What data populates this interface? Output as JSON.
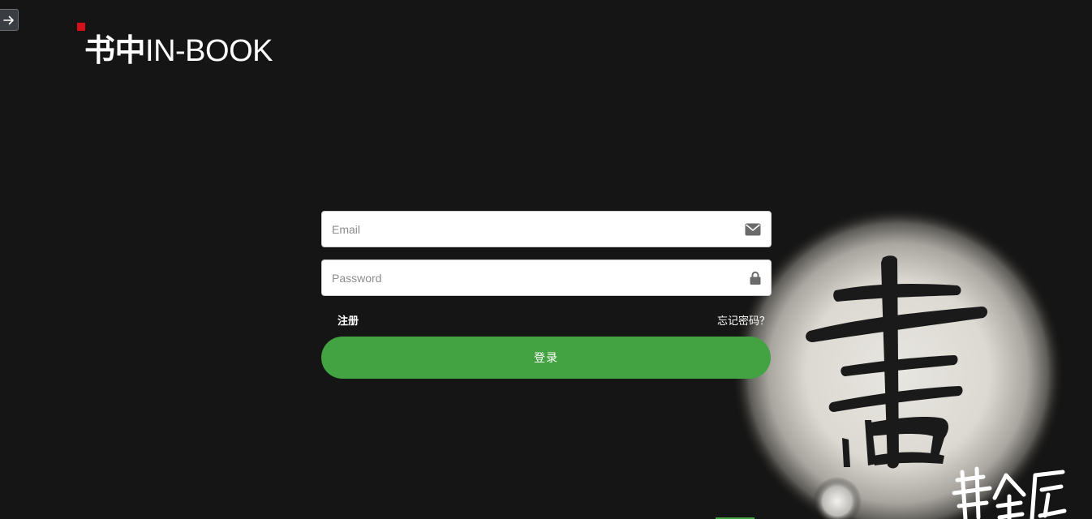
{
  "sidebar_toggle": {
    "icon": "arrow-right-icon"
  },
  "brand": {
    "name_cn": "书中",
    "name_en": "IN-BOOK",
    "accent_color": "#d4111b"
  },
  "login_form": {
    "email": {
      "placeholder": "Email",
      "value": "",
      "icon": "envelope-icon"
    },
    "password": {
      "placeholder": "Password",
      "value": "",
      "icon": "lock-icon"
    },
    "register_label": "注册",
    "forgot_label": "忘记密码？",
    "submit_label": "登录",
    "submit_color": "#43a242"
  },
  "decoration": {
    "main_character": "書",
    "signature": "黄金屋"
  }
}
